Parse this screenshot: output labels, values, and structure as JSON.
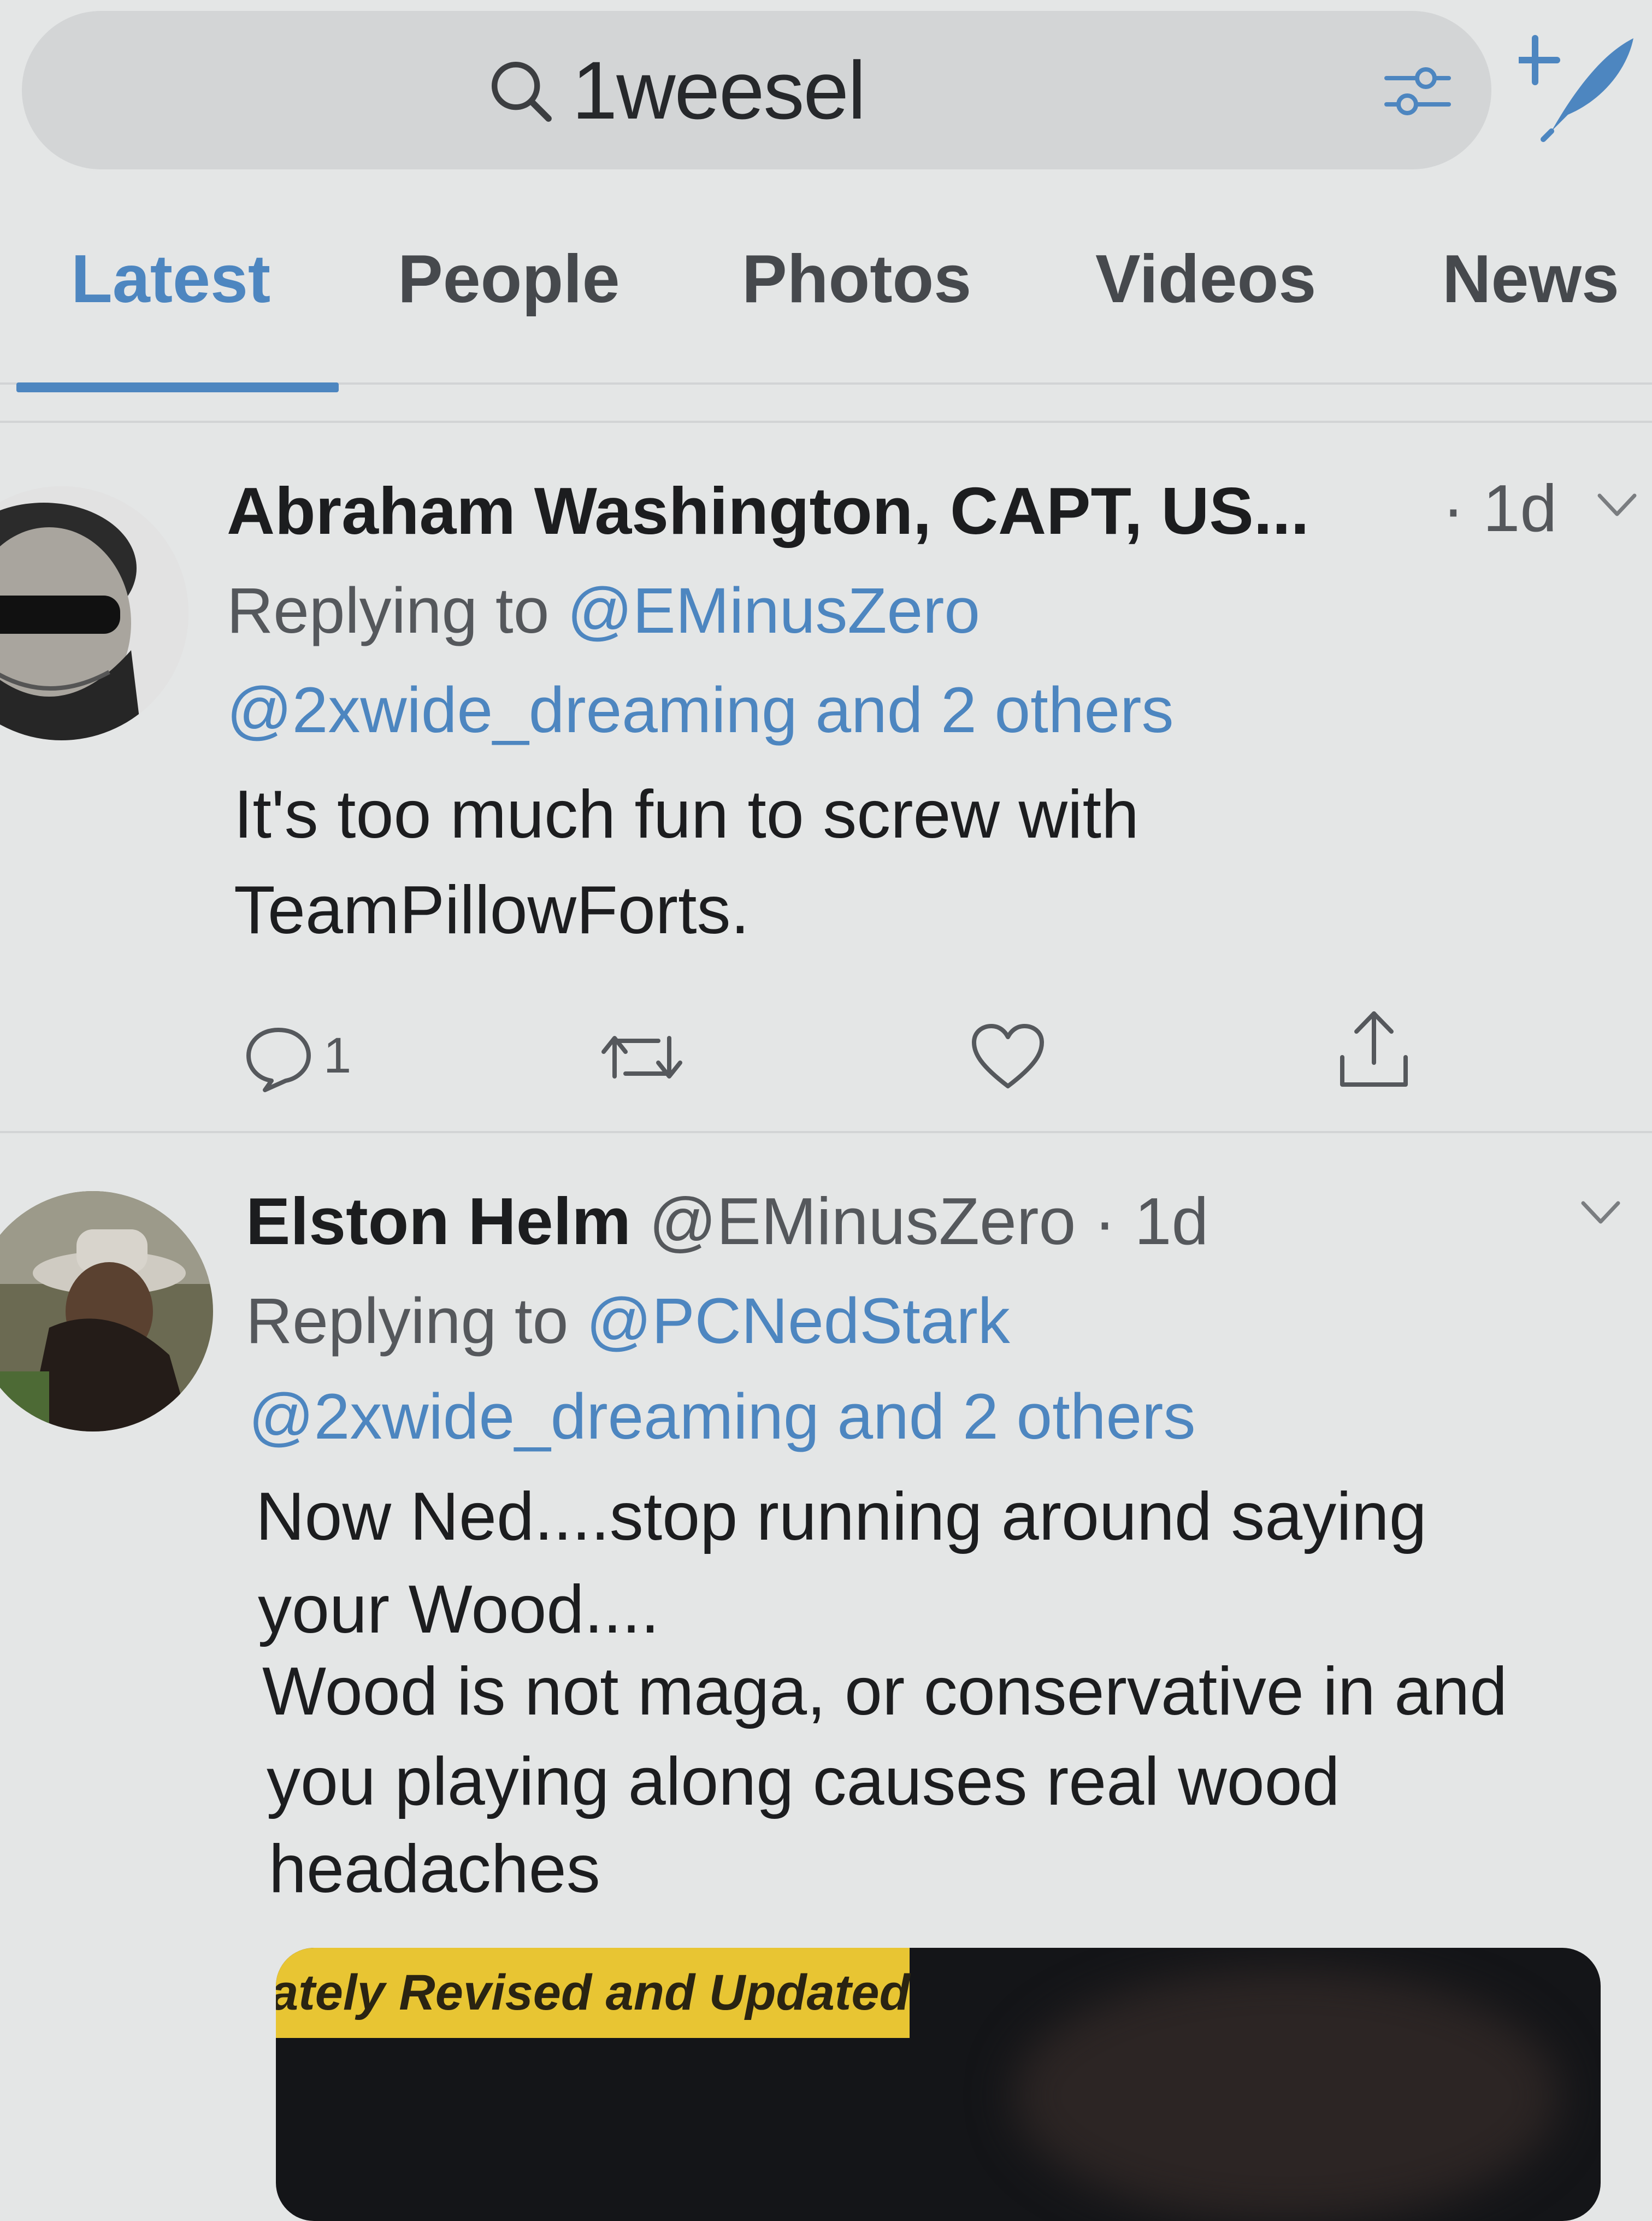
{
  "search": {
    "query": "1weesel"
  },
  "tabs": [
    {
      "label": "Latest",
      "active": true
    },
    {
      "label": "People"
    },
    {
      "label": "Photos"
    },
    {
      "label": "Videos"
    },
    {
      "label": "News"
    }
  ],
  "colors": {
    "accent": "#4d86c0",
    "background": "#e4e6e6"
  },
  "tweets": [
    {
      "name": "Abraham Washington, CAPT, US...",
      "time": "· 1d",
      "replying_prefix": "Replying to",
      "replying_to": "@EMinusZero",
      "replying_more": "@2xwide_dreaming and 2 others",
      "body_lines": [
        "It's too much fun to screw with",
        "TeamPillowForts."
      ],
      "reply_count": "1"
    },
    {
      "name": "Elston Helm",
      "handle": "@EMinusZero",
      "time": "· 1d",
      "replying_prefix": "Replying to",
      "replying_to": "@PCNedStark",
      "replying_more": "@2xwide_dreaming and 2 others",
      "body_lines": [
        "Now Ned....stop running around saying",
        "your Wood....",
        "Wood is not maga, or conservative in and",
        "you playing along causes real wood",
        "headaches"
      ],
      "media_caption": "ately Revised and Updated"
    }
  ]
}
